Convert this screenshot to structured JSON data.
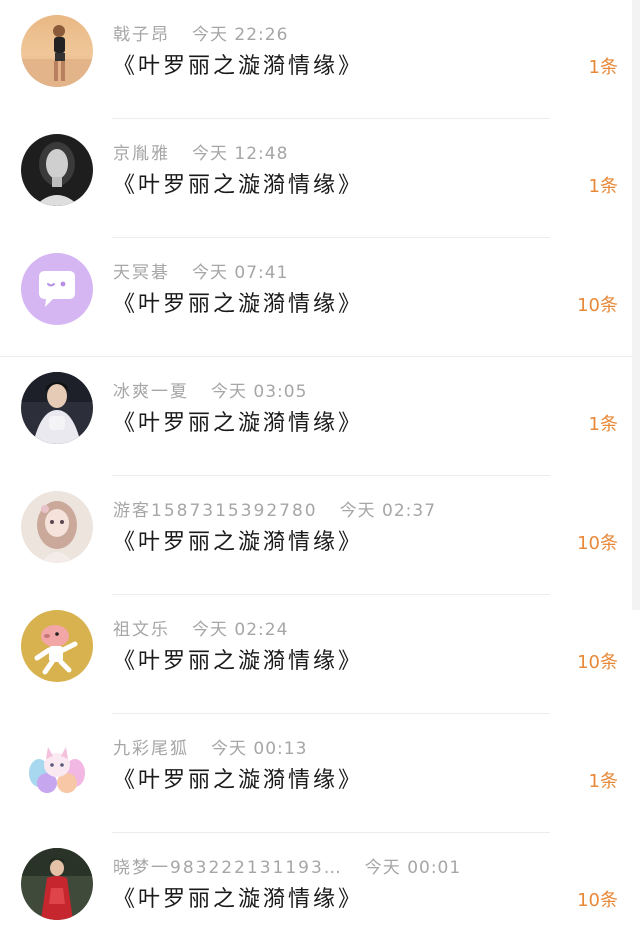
{
  "items": [
    {
      "name": "戟子昂",
      "time": "今天 22:26",
      "title": "《叶罗丽之漩漪情缘》",
      "count": "1条",
      "avatar": "woman-beach-avatar"
    },
    {
      "name": "京胤雅",
      "time": "今天 12:48",
      "title": "《叶罗丽之漩漪情缘》",
      "count": "1条",
      "avatar": "woman-bw-avatar"
    },
    {
      "name": "天冥碁",
      "time": "今天 07:41",
      "title": "《叶罗丽之漩漪情缘》",
      "count": "10条",
      "avatar": "default-chat-avatar"
    },
    {
      "name": "冰爽一夏",
      "time": "今天 03:05",
      "title": "《叶罗丽之漩漪情缘》",
      "count": "1条",
      "avatar": "costume-actor-avatar"
    },
    {
      "name": "游客1587315392780",
      "time": "今天 02:37",
      "title": "《叶罗丽之漩漪情缘》",
      "count": "10条",
      "avatar": "anime-girl-avatar"
    },
    {
      "name": "祖文乐",
      "time": "今天 02:24",
      "title": "《叶罗丽之漩漪情缘》",
      "count": "10条",
      "avatar": "cartoon-pig-avatar"
    },
    {
      "name": "九彩尾狐",
      "time": "今天 00:13",
      "title": "《叶罗丽之漩漪情缘》",
      "count": "1条",
      "avatar": "nine-tail-fox-avatar"
    },
    {
      "name": "晓梦一983222131193…",
      "time": "今天 00:01",
      "title": "《叶罗丽之漩漪情缘》",
      "count": "10条",
      "avatar": "woman-red-dress-avatar"
    }
  ],
  "colors": {
    "count": "#e8893a",
    "meta": "#a6a6a6",
    "title": "#1a1a1a",
    "divider": "#ececec"
  }
}
